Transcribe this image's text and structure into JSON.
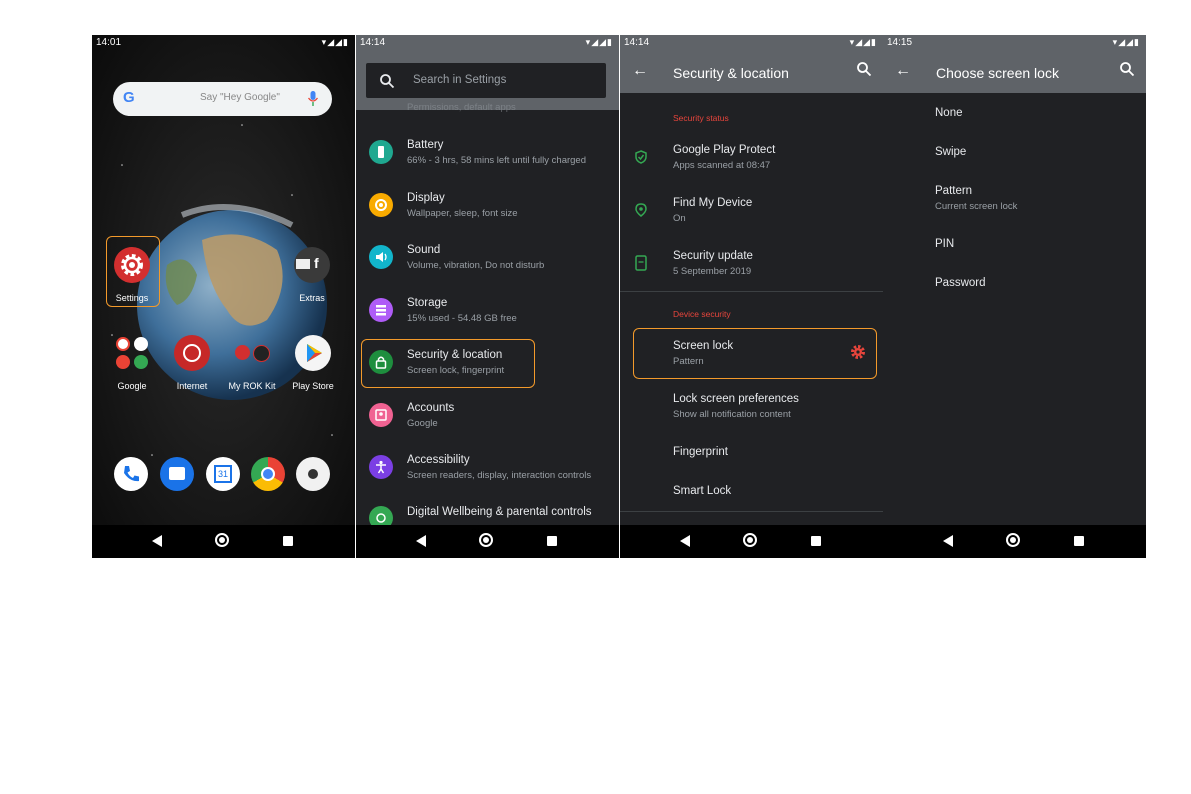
{
  "home": {
    "time": "14:01",
    "search_placeholder": "Say \"Hey Google\"",
    "apps": {
      "settings": "Settings",
      "extras": "Extras",
      "google": "Google",
      "internet": "Internet",
      "rok": "My ROK Kit",
      "playstore": "Play Store"
    },
    "colors": {
      "highlight": "#f39a2b",
      "settings_red": "#d32f2f"
    }
  },
  "settings": {
    "time": "14:14",
    "search_placeholder": "Search in Settings",
    "partial_top": "Permissions, default apps",
    "items": [
      {
        "title": "Battery",
        "subtitle": "66% - 3 hrs, 58 mins left until fully charged",
        "icon": "battery-icon",
        "color": "#1fa890"
      },
      {
        "title": "Display",
        "subtitle": "Wallpaper, sleep, font size",
        "icon": "brightness-icon",
        "color": "#f9ab00"
      },
      {
        "title": "Sound",
        "subtitle": "Volume, vibration, Do not disturb",
        "icon": "volume-icon",
        "color": "#12b5cb"
      },
      {
        "title": "Storage",
        "subtitle": "15% used - 54.48 GB free",
        "icon": "storage-icon",
        "color": "#af5cf7"
      },
      {
        "title": "Security & location",
        "subtitle": "Screen lock, fingerprint",
        "icon": "lock-icon",
        "color": "#1e8e3e"
      },
      {
        "title": "Accounts",
        "subtitle": "Google",
        "icon": "account-icon",
        "color": "#f06292"
      },
      {
        "title": "Accessibility",
        "subtitle": "Screen readers, display, interaction controls",
        "icon": "accessibility-icon",
        "color": "#7b3fe4"
      },
      {
        "title": "Digital Wellbeing & parental controls",
        "subtitle": "",
        "icon": "wellbeing-icon",
        "color": "#34a853"
      }
    ]
  },
  "security": {
    "time": "14:14",
    "title": "Security & location",
    "section_status": "Security status",
    "status_items": [
      {
        "title": "Google Play Protect",
        "subtitle": "Apps scanned at 08:47",
        "icon": "shield-check-icon"
      },
      {
        "title": "Find My Device",
        "subtitle": "On",
        "icon": "location-icon"
      },
      {
        "title": "Security update",
        "subtitle": "5 September 2019",
        "icon": "phone-update-icon"
      }
    ],
    "section_device": "Device security",
    "device_items": [
      {
        "title": "Screen lock",
        "subtitle": "Pattern"
      },
      {
        "title": "Lock screen preferences",
        "subtitle": "Show all notification content"
      },
      {
        "title": "Fingerprint",
        "subtitle": ""
      },
      {
        "title": "Smart Lock",
        "subtitle": ""
      }
    ],
    "colors": {
      "accent_red": "#e8453c",
      "icon_green": "#34a853"
    }
  },
  "lock": {
    "time": "14:15",
    "title": "Choose screen lock",
    "options": [
      {
        "title": "None",
        "subtitle": ""
      },
      {
        "title": "Swipe",
        "subtitle": ""
      },
      {
        "title": "Pattern",
        "subtitle": "Current screen lock"
      },
      {
        "title": "PIN",
        "subtitle": ""
      },
      {
        "title": "Password",
        "subtitle": ""
      }
    ]
  }
}
